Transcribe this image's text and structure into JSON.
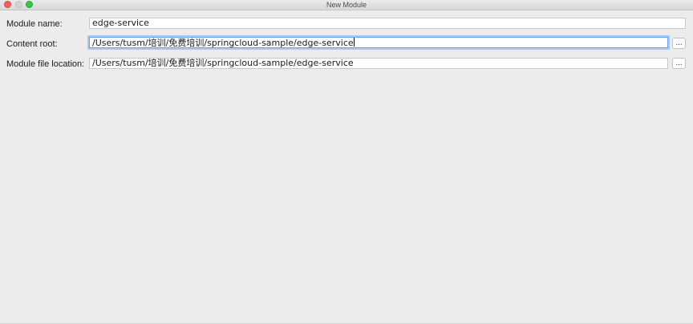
{
  "window": {
    "title": "New Module",
    "controls": [
      "close-button",
      "minimize-button",
      "zoom-button"
    ]
  },
  "form": {
    "module_name": {
      "label": "Module name:",
      "value": "edge-service"
    },
    "content_root": {
      "label": "Content root:",
      "value": "/Users/tusm/培训/免费培训/springcloud-sample/edge-service",
      "browse_label": "..."
    },
    "module_file_location": {
      "label": "Module file location:",
      "value": "/Users/tusm/培训/免费培训/springcloud-sample/edge-service",
      "browse_label": "..."
    }
  },
  "colors": {
    "background": "#ececec",
    "focus_ring": "#6ea2e8",
    "close": "#fc5f57",
    "zoom": "#34c84a"
  }
}
